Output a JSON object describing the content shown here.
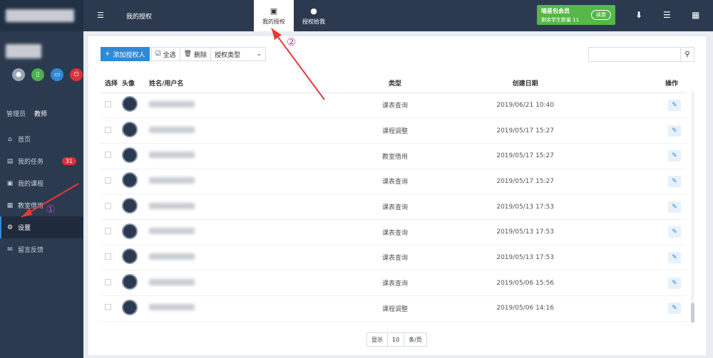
{
  "sidebar": {
    "roles": [
      "管理员",
      "教师"
    ],
    "items": [
      {
        "icon": "home-icon",
        "glyph": "⌂",
        "label": "首页"
      },
      {
        "icon": "tasks-icon",
        "glyph": "▤",
        "label": "我的任务",
        "badge": "31"
      },
      {
        "icon": "calendar-icon",
        "glyph": "▣",
        "label": "我的课程"
      },
      {
        "icon": "grid-icon",
        "glyph": "▦",
        "label": "教室借用"
      },
      {
        "icon": "gear-icon",
        "glyph": "⚙",
        "label": "设置"
      },
      {
        "icon": "chat-icon",
        "glyph": "✉",
        "label": "留言反馈"
      }
    ]
  },
  "header": {
    "title": "我的授权",
    "tabs": [
      {
        "label": "我的授权",
        "icon": "user-card-icon"
      },
      {
        "label": "授权给我",
        "icon": "user-icon"
      }
    ],
    "member": {
      "title": "喵星包会员",
      "subtitle": "剩余学生数量 11",
      "renew": "续费"
    }
  },
  "toolbar": {
    "add_label": "添加授权人",
    "select_all_label": "全选",
    "delete_label": "删除",
    "type_select": "授权类型"
  },
  "table": {
    "headers": [
      "选择",
      "头像",
      "姓名/用户名",
      "类型",
      "创建日期",
      "操作"
    ],
    "rows": [
      {
        "type": "课表查询",
        "date": "2019/06/21 10:40"
      },
      {
        "type": "课程调整",
        "date": "2019/05/17 15:27"
      },
      {
        "type": "教室借用",
        "date": "2019/05/17 15:27"
      },
      {
        "type": "课表查询",
        "date": "2019/05/17 15:27"
      },
      {
        "type": "课表查询",
        "date": "2019/05/13 17:53"
      },
      {
        "type": "课表查询",
        "date": "2019/05/13 17:53"
      },
      {
        "type": "课表查询",
        "date": "2019/05/13 17:53"
      },
      {
        "type": "课表查询",
        "date": "2019/05/06 15:56"
      },
      {
        "type": "课程调整",
        "date": "2019/05/06 14:16"
      }
    ]
  },
  "pager": {
    "show_label": "显示",
    "page_size": "10",
    "per_page_label": "条/页"
  },
  "annotations": [
    "①",
    "②"
  ],
  "colors": {
    "sidebar": "#2c3a4f",
    "accent": "#2f8ad6",
    "member": "#56b847",
    "badge": "#d9323a"
  }
}
